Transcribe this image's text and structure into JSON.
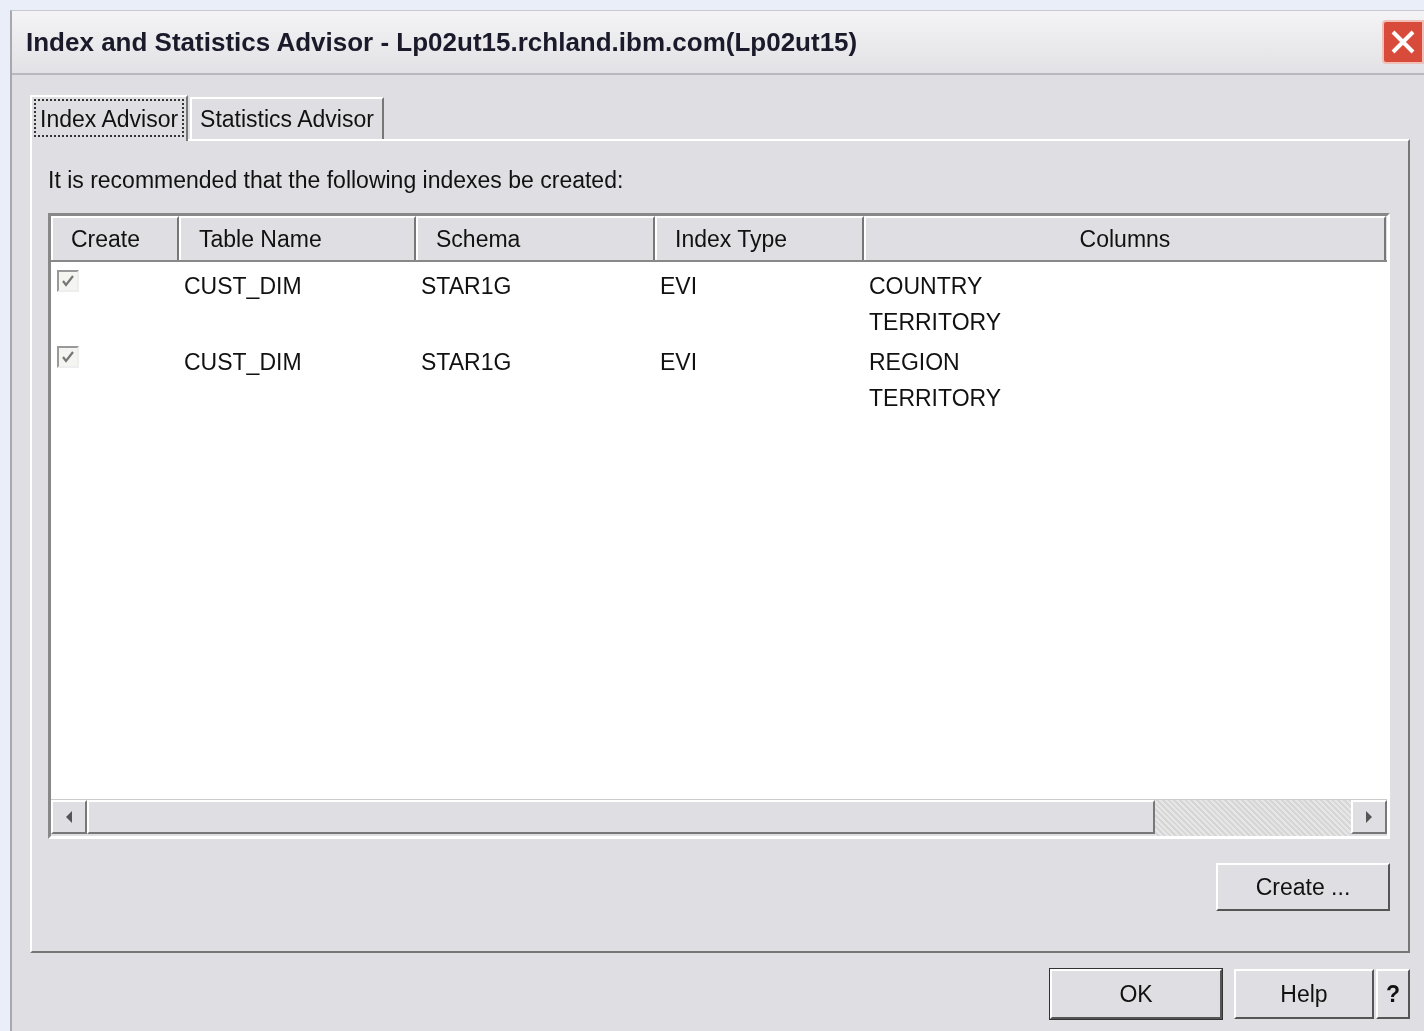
{
  "window": {
    "title": "Index and Statistics Advisor - Lp02ut15.rchland.ibm.com(Lp02ut15)"
  },
  "tabs": [
    {
      "label": "Index Advisor",
      "selected": true
    },
    {
      "label": "Statistics Advisor",
      "selected": false
    }
  ],
  "message": "It is recommended that the following indexes be created:",
  "table": {
    "columns": [
      "Create",
      "Table Name",
      "Schema",
      "Index Type",
      "Columns"
    ],
    "rows": [
      {
        "checked": true,
        "table_name": "CUST_DIM",
        "schema": "STAR1G",
        "index_type": "EVI",
        "columns": [
          "COUNTRY",
          "TERRITORY"
        ]
      },
      {
        "checked": true,
        "table_name": "CUST_DIM",
        "schema": "STAR1G",
        "index_type": "EVI",
        "columns": [
          "REGION",
          "TERRITORY"
        ]
      }
    ]
  },
  "panel_button": "Create ...",
  "buttons": [
    "OK",
    "Help",
    "?"
  ]
}
